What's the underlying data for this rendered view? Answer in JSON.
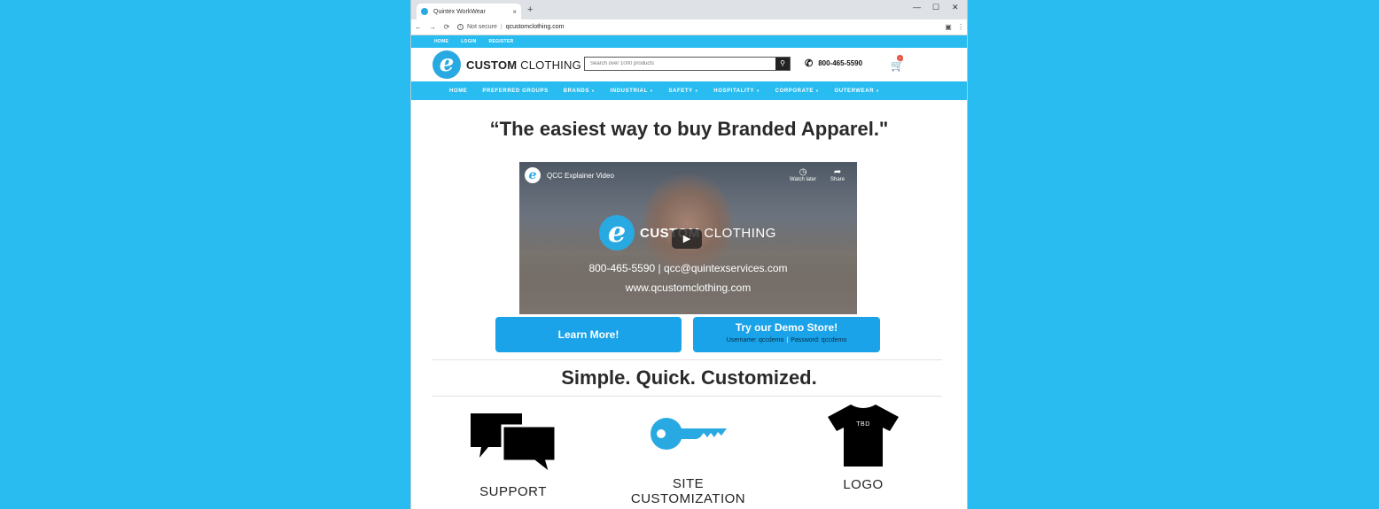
{
  "browser": {
    "tab_title": "Quintex WorkWear",
    "tab_close": "×",
    "new_tab": "+",
    "security": "Not secure",
    "url": "qcustomclothing.com",
    "controls": {
      "minimize": "—",
      "maximize": "☐",
      "close": "✕"
    }
  },
  "site": {
    "topnav": [
      "HOME",
      "LOGIN",
      "REGISTER"
    ],
    "logo": {
      "mark": "e",
      "word1": "CUSTOM",
      "word2": "CLOTHING"
    },
    "search": {
      "placeholder": "Search over 1000 products"
    },
    "phone": "800-465-5590",
    "cart_count": "0",
    "mainnav": [
      "HOME",
      "PREFERRED GROUPS",
      "BRANDS",
      "INDUSTRIAL",
      "SAFETY",
      "HOSPITALITY",
      "CORPORATE",
      "OUTERWEAR"
    ],
    "headline": "“The easiest way to buy Branded Apparel.\"",
    "video": {
      "title": "QCC Explainer Video",
      "watch_later": "Watch later",
      "share": "Share",
      "logo_word1": "CUSTOM",
      "logo_word2": "CLOTHING",
      "contact": "800-465-5590 | qcc@quintexservices.com",
      "website": "www.qcustomclothing.com"
    },
    "learn_more": "Learn More!",
    "demo": {
      "title": "Try our Demo Store!",
      "username": "Username: qccdemo",
      "password": "Password: qccdemo"
    },
    "tagline": "Simple. Quick. Customized.",
    "features": [
      "SUPPORT",
      "SITE CUSTOMIZATION",
      "LOGO"
    ],
    "shirt_text": "TBD",
    "accent_color": "#29bcf0"
  }
}
